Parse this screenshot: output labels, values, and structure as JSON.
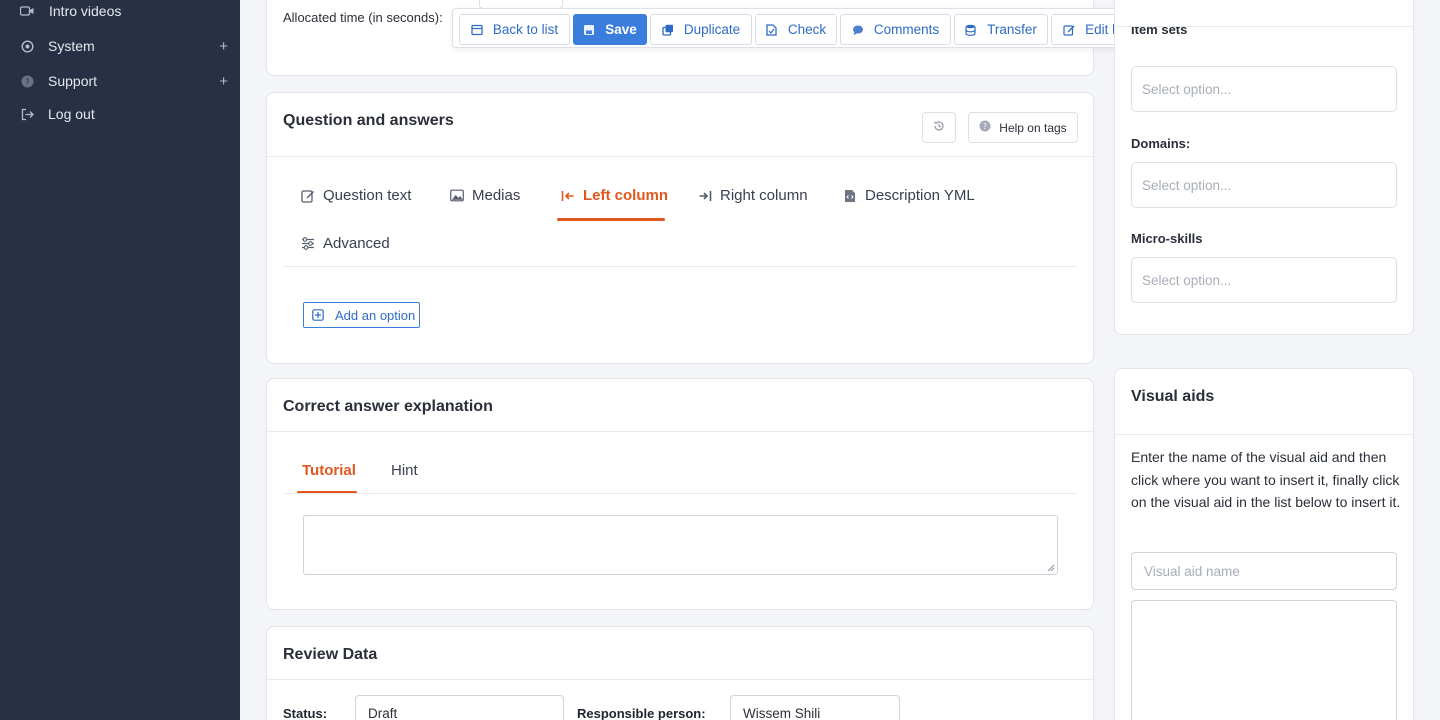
{
  "sidebar": {
    "items": [
      {
        "label": "Intro videos",
        "icon": "video-icon",
        "expandable": false
      },
      {
        "label": "System",
        "icon": "gear-icon",
        "expandable": true
      },
      {
        "label": "Support",
        "icon": "help-icon",
        "expandable": true
      },
      {
        "label": "Log out",
        "icon": "logout-icon",
        "expandable": false
      }
    ],
    "expand_symbol": "+"
  },
  "toolbar": {
    "back": "Back to list",
    "save": "Save",
    "duplicate": "Duplicate",
    "check": "Check",
    "comments": "Comments",
    "transfer": "Transfer",
    "edit_linked": "Edit linked questions"
  },
  "allocated": {
    "label": "Allocated time (in seconds):"
  },
  "qa": {
    "title": "Question and answers",
    "help_tags": "Help on tags",
    "tabs": [
      {
        "label": "Question text",
        "icon": "pencil-icon"
      },
      {
        "label": "Medias",
        "icon": "image-icon"
      },
      {
        "label": "Left column",
        "icon": "arrow-left-bar-icon"
      },
      {
        "label": "Right column",
        "icon": "arrow-right-bar-icon"
      },
      {
        "label": "Description YML",
        "icon": "file-code-icon"
      },
      {
        "label": "Advanced",
        "icon": "sliders-icon"
      }
    ],
    "active_tab": "Left column",
    "add_option": "Add an option"
  },
  "explanation": {
    "title": "Correct answer explanation",
    "tabs": [
      "Tutorial",
      "Hint"
    ],
    "active_tab": "Tutorial"
  },
  "review": {
    "title": "Review Data",
    "status_label": "Status:",
    "status_value": "Draft",
    "responsible_label": "Responsible person:",
    "responsible_value": "Wissem Shili"
  },
  "right_panel": {
    "item_sets_label": "Item sets",
    "domains_label": "Domains:",
    "micro_skills_label": "Micro-skills",
    "select_placeholder": "Select option..."
  },
  "visual_aids": {
    "title": "Visual aids",
    "description": "Enter the name of the visual aid and then click where you want to insert it, finally click on the visual aid in the list below to insert it.",
    "input_placeholder": "Visual aid name"
  },
  "colors": {
    "sidebar_bg": "#283046",
    "accent_orange": "#e0581f",
    "primary_blue": "#3b7ddd",
    "page_bg": "#f4f5f8"
  }
}
